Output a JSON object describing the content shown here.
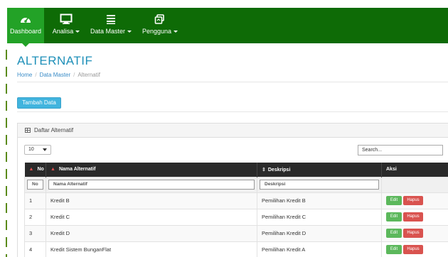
{
  "nav": {
    "items": [
      {
        "label": "Dashboard",
        "icon": "tachometer-icon",
        "active": true
      },
      {
        "label": "Analisa",
        "icon": "monitor-icon",
        "dropdown": true
      },
      {
        "label": "Data Master",
        "icon": "list-icon",
        "dropdown": true
      },
      {
        "label": "Pengguna",
        "icon": "users-icon",
        "dropdown": true
      }
    ]
  },
  "page": {
    "title": "ALTERNATIF",
    "breadcrumb": [
      "Home",
      "Data Master",
      "Alternatif"
    ]
  },
  "add_button": "Tambah Data",
  "panel": {
    "title": "Daftar Alternatif",
    "length_value": "10",
    "search_placeholder": "Search..."
  },
  "table": {
    "headers": [
      "No",
      "Nama Alternatif",
      "Deskripsi",
      "Aksi"
    ],
    "filters": [
      "No",
      "Nama Alternatif",
      "Deskripsi"
    ],
    "rows": [
      [
        "1",
        "Kredit B",
        "Pemilihan Kredit B"
      ],
      [
        "2",
        "Kredit C",
        "Pemilihan Kredit C"
      ],
      [
        "3",
        "Kredit D",
        "Pemilihan Kredit D"
      ],
      [
        "4",
        "Kredit Sistem BunganFlat",
        "Pemilihan Kredit A"
      ]
    ],
    "edit_label": "Edit",
    "delete_label": "Hapus"
  },
  "colors": {
    "navbar": "#0e6b06",
    "nav_active": "#23a227",
    "title": "#1d8fb8",
    "add_button": "#41b4de",
    "edit": "#5cb85c",
    "delete": "#d9534f",
    "table_header": "#2a2a2a"
  }
}
